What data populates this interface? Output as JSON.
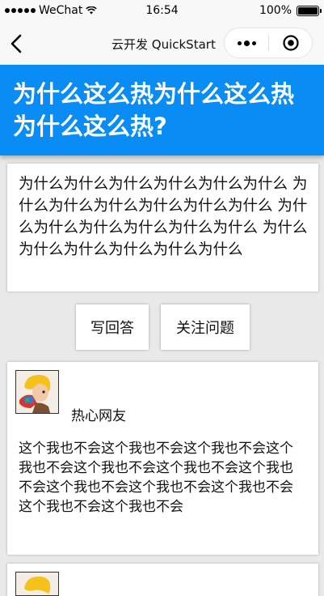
{
  "status_bar": {
    "carrier": "WeChat",
    "time": "16:54",
    "battery": "100%"
  },
  "nav": {
    "title": "云开发 QuickStart",
    "more_icon": "more-dots-icon",
    "close_icon": "target-close-icon"
  },
  "question": {
    "title": "为什么这么热为什么这么热为什么这么热?",
    "description": "为什么为什么为什么为什么为什么为什么 为什么为什么为什么为什么为什么为什么 为什么为什么为什么为什么为什么为什么 为什么为什么为什么为什么为什么为什么"
  },
  "actions": {
    "answer_label": "写回答",
    "follow_label": "关注问题"
  },
  "answers": [
    {
      "author": "热心网友",
      "text": "这个我也不会这个我也不会这个我也不会这个我也不会这个我也不会这个我也不会这个我也不会这个我也不会这个我也不会这个我也不会这个我也不会这个我也不会"
    }
  ],
  "colors": {
    "header_blue": "#0a8cf5",
    "page_bg": "#e9e9e9"
  }
}
